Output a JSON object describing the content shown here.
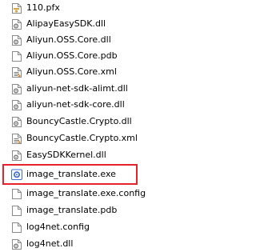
{
  "files": [
    {
      "name": "110.pfx",
      "icon": "certificate-file-icon"
    },
    {
      "name": "AlipayEasySDK.dll",
      "icon": "dll-file-icon"
    },
    {
      "name": "Aliyun.OSS.Core.dll",
      "icon": "dll-file-icon"
    },
    {
      "name": "Aliyun.OSS.Core.pdb",
      "icon": "blank-file-icon"
    },
    {
      "name": "Aliyun.OSS.Core.xml",
      "icon": "xml-file-icon"
    },
    {
      "name": "aliyun-net-sdk-alimt.dll",
      "icon": "dll-file-icon"
    },
    {
      "name": "aliyun-net-sdk-core.dll",
      "icon": "dll-file-icon"
    },
    {
      "name": "BouncyCastle.Crypto.dll",
      "icon": "dll-file-icon"
    },
    {
      "name": "BouncyCastle.Crypto.xml",
      "icon": "xml-file-icon"
    },
    {
      "name": "EasySDKKernel.dll",
      "icon": "dll-file-icon"
    },
    {
      "name": "image_translate.exe",
      "icon": "exe-file-icon"
    },
    {
      "name": "image_translate.exe.config",
      "icon": "config-file-icon"
    },
    {
      "name": "image_translate.pdb",
      "icon": "blank-file-icon"
    },
    {
      "name": "log4net.config",
      "icon": "config-file-icon"
    },
    {
      "name": "log4net.dll",
      "icon": "dll-file-icon"
    }
  ],
  "highlighted_file": "image_translate.exe",
  "colors": {
    "highlight_border": "#e8212b",
    "exe_icon_accent": "#3b6fd1"
  }
}
